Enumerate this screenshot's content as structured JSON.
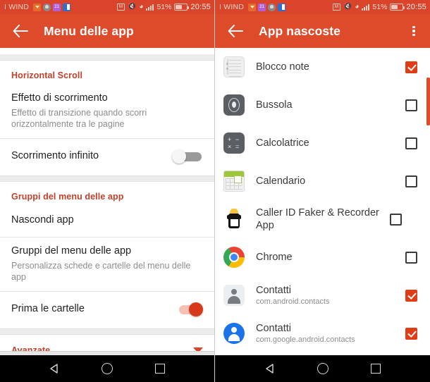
{
  "statusbar": {
    "carrier": "I WIND",
    "battery_pct": "51%",
    "clock": "20:55",
    "left_icons": [
      "download-icon",
      "cloud-icon",
      "calendar-badge-icon",
      "contacts-sync-icon"
    ],
    "right_icons": [
      "vpn-icon",
      "mute-icon",
      "wifi-icon",
      "signal-icon",
      "battery-icon"
    ]
  },
  "left_panel": {
    "appbar": {
      "back": "back-arrow",
      "title": "Menu delle app"
    },
    "groups": [
      {
        "heading": "Horizontal Scroll",
        "rows": [
          {
            "title": "Effetto di scorrimento",
            "subtitle": "Effetto di transizione quando scorri orizzontalmente tra le pagine",
            "control": "none"
          },
          {
            "title": "Scorrimento infinito",
            "subtitle": "",
            "control": "toggle",
            "toggle_state": "off"
          }
        ]
      },
      {
        "heading": "Gruppi del menu delle app",
        "rows": [
          {
            "title": "Nascondi app",
            "subtitle": "",
            "control": "none"
          },
          {
            "title": "Gruppi del menu delle app",
            "subtitle": "Personalizza schede e cartelle del menu delle app",
            "control": "none"
          },
          {
            "title": "Prima le cartelle",
            "subtitle": "",
            "control": "toggle",
            "toggle_state": "on"
          }
        ]
      },
      {
        "heading": "Avanzate",
        "expandable": true,
        "rows": []
      }
    ]
  },
  "right_panel": {
    "appbar": {
      "back": "back-arrow",
      "title": "App nascoste",
      "overflow": "more-options"
    },
    "apps": [
      {
        "name": "Blocco note",
        "package": "",
        "icon": "notepad-icon",
        "checked": true
      },
      {
        "name": "Bussola",
        "package": "",
        "icon": "compass-icon",
        "checked": false
      },
      {
        "name": "Calcolatrice",
        "package": "",
        "icon": "calculator-icon",
        "checked": false
      },
      {
        "name": "Calendario",
        "package": "",
        "icon": "calendar-icon",
        "checked": false
      },
      {
        "name": "Caller ID Faker & Recorder App",
        "package": "",
        "icon": "caller-id-faker-icon",
        "checked": false
      },
      {
        "name": "Chrome",
        "package": "",
        "icon": "chrome-icon",
        "checked": false
      },
      {
        "name": "Contatti",
        "package": "com.android.contacts",
        "icon": "contacts-gray-icon",
        "checked": true
      },
      {
        "name": "Contatti",
        "package": "com.google.android.contacts",
        "icon": "contacts-blue-icon",
        "checked": true
      }
    ]
  },
  "navbar": {
    "back": "nav-back-icon",
    "home": "nav-home-icon",
    "recents": "nav-recents-icon"
  },
  "colors": {
    "accent": "#dd4b2b",
    "statusbar": "#d9442a",
    "heading": "#c2412a",
    "checkbox_checked": "#e03c16",
    "toggle_on": "#d9391b"
  }
}
